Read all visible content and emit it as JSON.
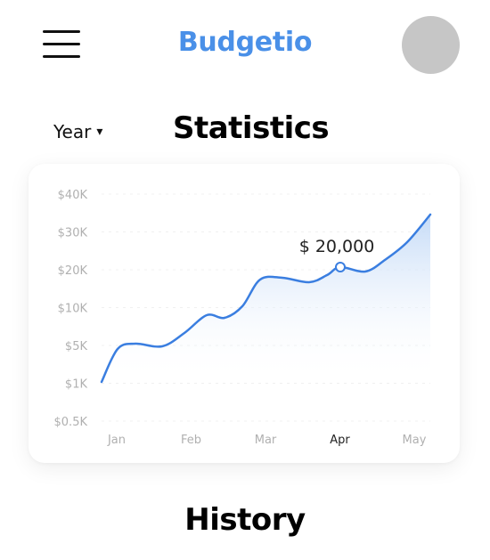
{
  "header": {
    "app_title": "Budgetio",
    "menu_icon": "hamburger-menu-icon",
    "avatar_icon": "user-avatar"
  },
  "stats": {
    "period_label": "Year",
    "period_caret": "▾",
    "title": "Statistics"
  },
  "history": {
    "title": "History"
  },
  "colors": {
    "brand": "#4a90e8",
    "line": "#3a7ee0",
    "area_top": "#c5dbf7",
    "axis_text": "#b0b0b0",
    "highlight_text": "#222222"
  },
  "chart_data": {
    "type": "area",
    "x_categories": [
      "Jan",
      "Feb",
      "Mar",
      "Apr",
      "May"
    ],
    "highlight_category": "Apr",
    "y_ticks": [
      "$40K",
      "$30K",
      "$20K",
      "$10K",
      "$5K",
      "$1K",
      "$0.5K"
    ],
    "series": [
      {
        "points": [
          {
            "x": "Jan",
            "y": "$1K"
          },
          {
            "x": "Jan",
            "y": "$5K"
          },
          {
            "x": "Feb",
            "y": "$5K"
          },
          {
            "x": "Feb",
            "y": "$8K"
          },
          {
            "x": "Mar",
            "y": "$18K"
          },
          {
            "x": "Apr",
            "y": "$20K"
          },
          {
            "x": "May",
            "y": "$35K"
          }
        ]
      }
    ],
    "highlight": {
      "x": "Apr",
      "label": "$ 20,000"
    },
    "grid": true
  }
}
